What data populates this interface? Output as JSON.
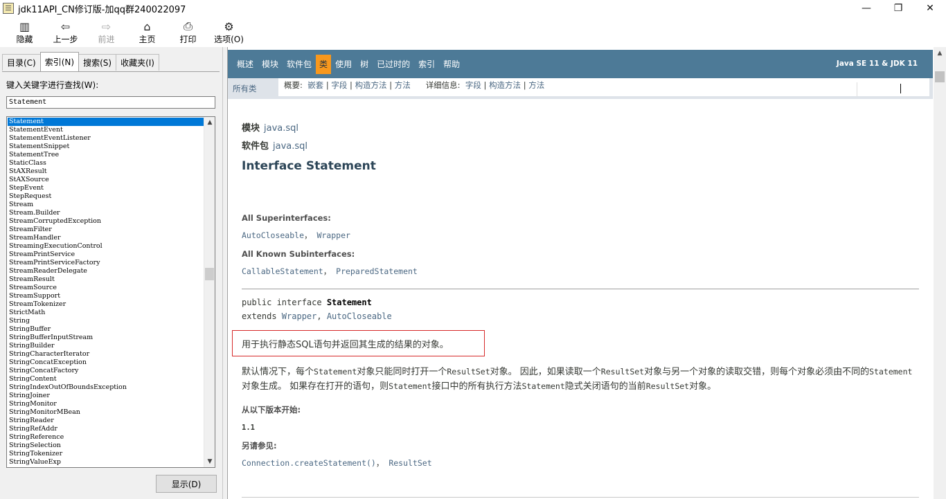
{
  "window": {
    "title": "jdk11API_CN修订版-加qq群240022097",
    "minimize_glyph": "—",
    "maximize_glyph": "❐",
    "close_glyph": "✕"
  },
  "toolbar": {
    "items": [
      {
        "label": "隐藏",
        "icon": "hide-icon",
        "glyph": "▥",
        "enabled": true
      },
      {
        "label": "上一步",
        "icon": "back-arrow-icon",
        "glyph": "⇦",
        "enabled": true
      },
      {
        "label": "前进",
        "icon": "forward-arrow-icon",
        "glyph": "⇨",
        "enabled": false
      },
      {
        "label": "主页",
        "icon": "home-icon",
        "glyph": "⌂",
        "enabled": true
      },
      {
        "label": "打印",
        "icon": "printer-icon",
        "glyph": "⎙",
        "enabled": true
      },
      {
        "label": "选项(O)",
        "icon": "options-icon",
        "glyph": "⚙",
        "enabled": true
      }
    ]
  },
  "left_pane": {
    "tabs": [
      "目录(C)",
      "索引(N)",
      "搜索(S)",
      "收藏夹(I)"
    ],
    "active_tab": "索引(N)",
    "keyword_label": "键入关键字进行查找(W):",
    "keyword_value": "Statement",
    "index_items": [
      "Statement",
      "StatementEvent",
      "StatementEventListener",
      "StatementSnippet",
      "StatementTree",
      "StaticClass",
      "StAXResult",
      "StAXSource",
      "StepEvent",
      "StepRequest",
      "Stream",
      "Stream.Builder",
      "StreamCorruptedException",
      "StreamFilter",
      "StreamHandler",
      "StreamingExecutionControl",
      "StreamPrintService",
      "StreamPrintServiceFactory",
      "StreamReaderDelegate",
      "StreamResult",
      "StreamSource",
      "StreamSupport",
      "StreamTokenizer",
      "StrictMath",
      "String",
      "StringBuffer",
      "StringBufferInputStream",
      "StringBuilder",
      "StringCharacterIterator",
      "StringConcatException",
      "StringConcatFactory",
      "StringContent",
      "StringIndexOutOfBoundsException",
      "StringJoiner",
      "StringMonitor",
      "StringMonitorMBean",
      "StringReader",
      "StringRefAddr",
      "StringReference",
      "StringSelection",
      "StringTokenizer",
      "StringValueExp"
    ],
    "selected_item": "Statement",
    "display_button": "显示(D)"
  },
  "doc": {
    "nav": {
      "items": [
        "概述",
        "模块",
        "软件包",
        "类",
        "使用",
        "树",
        "已过时的",
        "索引",
        "帮助"
      ],
      "current": "类",
      "brand": "Java SE 11 & JDK 11"
    },
    "subnav": {
      "all_classes": "所有类",
      "summary_label": "概要:",
      "summary_links": [
        "嵌套",
        "字段",
        "构造方法",
        "方法"
      ],
      "detail_label": "详细信息:",
      "detail_links": [
        "字段",
        "构造方法",
        "方法"
      ]
    },
    "module_label": "模块",
    "module_value": "java.sql",
    "package_label": "软件包",
    "package_value": "java.sql",
    "title": "Interface Statement",
    "superinterfaces_label": "All Superinterfaces:",
    "superinterfaces": [
      "AutoCloseable",
      "Wrapper"
    ],
    "subinterfaces_label": "All Known Subinterfaces:",
    "subinterfaces": [
      "CallableStatement",
      "PreparedStatement"
    ],
    "signature_line1_prefix": "public interface ",
    "signature_name": "Statement",
    "signature_line2_prefix": "extends ",
    "signature_extends": [
      "Wrapper",
      "AutoCloseable"
    ],
    "summary_sentence": "用于执行静态SQL语句并返回其生成的结果的对象。",
    "paragraph": [
      {
        "t": "默认情况下，每个",
        "m": false
      },
      {
        "t": "Statement",
        "m": true
      },
      {
        "t": "对象只能同时打开一个",
        "m": false
      },
      {
        "t": "ResultSet",
        "m": true
      },
      {
        "t": "对象。 因此，如果读取一个",
        "m": false
      },
      {
        "t": "ResultSet",
        "m": true
      },
      {
        "t": "对象与另一个对象的读取交错，则每个对象必须由不同的",
        "m": false
      },
      {
        "t": "Statement",
        "m": true
      },
      {
        "t": "对象生成。 如果存在打开的语句，则",
        "m": false
      },
      {
        "t": "Statement",
        "m": true
      },
      {
        "t": "接口中的所有执行方法",
        "m": false
      },
      {
        "t": "Statement",
        "m": true
      },
      {
        "t": "隐式关闭语句的当前",
        "m": false
      },
      {
        "t": "ResultSet",
        "m": true
      },
      {
        "t": "对象。",
        "m": false
      }
    ],
    "since_label": "从以下版本开始:",
    "since_value": "1.1",
    "see_also_label": "另请参见:",
    "see_also": [
      "Connection.createStatement()",
      "ResultSet"
    ]
  }
}
